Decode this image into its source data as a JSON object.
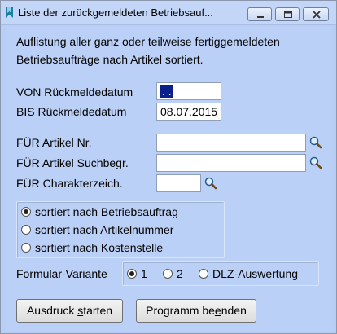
{
  "window": {
    "title": "Liste der zurückgemeldeten Betriebsauf...",
    "controls": [
      "minimize",
      "maximize",
      "close"
    ]
  },
  "description": {
    "line1": "Auflistung aller ganz oder teilweise fertiggemeldeten",
    "line2": "Betriebsaufträge nach Artikel sortiert."
  },
  "dates": {
    "von_label": "VON Rückmeldedatum",
    "von_value": ". .",
    "bis_label": "BIS Rückmeldedatum",
    "bis_value": "08.07.2015"
  },
  "filters": {
    "artikel_nr_label": "FÜR Artikel Nr.",
    "artikel_nr_value": "",
    "suchbegr_label": "FÜR Artikel Suchbegr.",
    "suchbegr_value": "",
    "charakter_label": "FÜR Charakterzeich.",
    "charakter_value": ""
  },
  "sort": {
    "options": [
      {
        "label": "sortiert nach Betriebsauftrag",
        "selected": true
      },
      {
        "label": "sortiert nach Artikelnummer",
        "selected": false
      },
      {
        "label": "sortiert nach Kostenstelle",
        "selected": false
      }
    ]
  },
  "variant": {
    "label": "Formular-Variante",
    "options": [
      {
        "label": "1",
        "selected": true
      },
      {
        "label": "2",
        "selected": false
      },
      {
        "label": "DLZ-Auswertung",
        "selected": false
      }
    ]
  },
  "buttons": {
    "print_pre": "Ausdruck ",
    "print_ul": "s",
    "print_post": "tarten",
    "end_pre": "Programm be",
    "end_ul": "e",
    "end_post": "nden"
  },
  "icons": {
    "lookup": "magnifier-icon",
    "title": "bookmark-icon"
  }
}
